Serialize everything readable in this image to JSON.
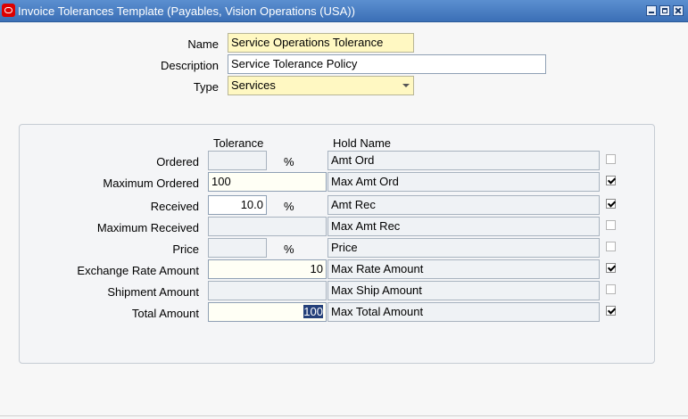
{
  "window": {
    "title": "Invoice Tolerances Template (Payables, Vision Operations (USA))"
  },
  "header_form": {
    "name_label": "Name",
    "name_value": "Service Operations Tolerance",
    "description_label": "Description",
    "description_value": "Service Tolerance Policy",
    "type_label": "Type",
    "type_value": "Services"
  },
  "columns": {
    "tolerance": "Tolerance",
    "hold_name": "Hold Name"
  },
  "rows": [
    {
      "label": "Ordered",
      "tolerance": "",
      "percent": "%",
      "hold": "Amt Ord",
      "checked": false
    },
    {
      "label": "Maximum Ordered",
      "tolerance": "100",
      "percent": "",
      "hold": "Max Amt Ord",
      "checked": true
    },
    {
      "label": "Received",
      "tolerance": "10.0",
      "percent": "%",
      "hold": "Amt Rec",
      "checked": true
    },
    {
      "label": "Maximum Received",
      "tolerance": "",
      "percent": "",
      "hold": "Max Amt Rec",
      "checked": false
    },
    {
      "label": "Price",
      "tolerance": "",
      "percent": "%",
      "hold": "Price",
      "checked": false
    },
    {
      "label": "Exchange Rate Amount",
      "tolerance": "10",
      "percent": "",
      "hold": "Max Rate Amount",
      "checked": true
    },
    {
      "label": "Shipment Amount",
      "tolerance": "",
      "percent": "",
      "hold": "Max Ship Amount",
      "checked": false
    },
    {
      "label": "Total Amount",
      "tolerance": "100",
      "percent": "",
      "hold": "Max Total Amount",
      "checked": true
    }
  ],
  "icons": {
    "app": "oracle-app-icon",
    "minimize": "minimize-icon",
    "maximize": "maximize-icon",
    "close": "close-icon",
    "dropdown": "chevron-down-icon"
  },
  "colors": {
    "titlebar": "#3b6fb6",
    "required_field": "#fff8c2",
    "selection": "#24407a"
  }
}
